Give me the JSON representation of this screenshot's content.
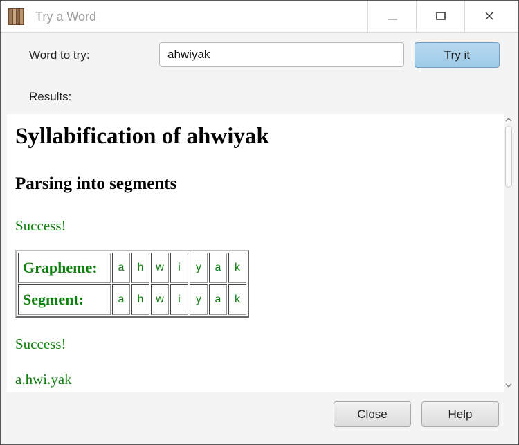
{
  "window": {
    "title": "Try a Word",
    "app_icon": "books-icon",
    "controls": [
      "minimize-icon",
      "maximize-icon",
      "close-icon"
    ]
  },
  "form": {
    "word_label": "Word to try:",
    "word_value": "ahwiyak",
    "try_button": "Try it",
    "results_label": "Results:"
  },
  "results": {
    "heading": "Syllabification of ahwiyak",
    "subheading": "Parsing into segments",
    "status_1": "Success!",
    "table": {
      "row_headers": [
        "Grapheme:",
        "Segment:"
      ],
      "graphemes": [
        "a",
        "h",
        "w",
        "i",
        "y",
        "a",
        "k"
      ],
      "segments": [
        "a",
        "h",
        "w",
        "i",
        "y",
        "a",
        "k"
      ]
    },
    "status_2": "Success!",
    "syllabified": "a.hwi.yak"
  },
  "footer": {
    "close_button": "Close",
    "help_button": "Help"
  },
  "colors": {
    "success_green": "#108010",
    "default_button_blue": "#9fcbe8"
  }
}
